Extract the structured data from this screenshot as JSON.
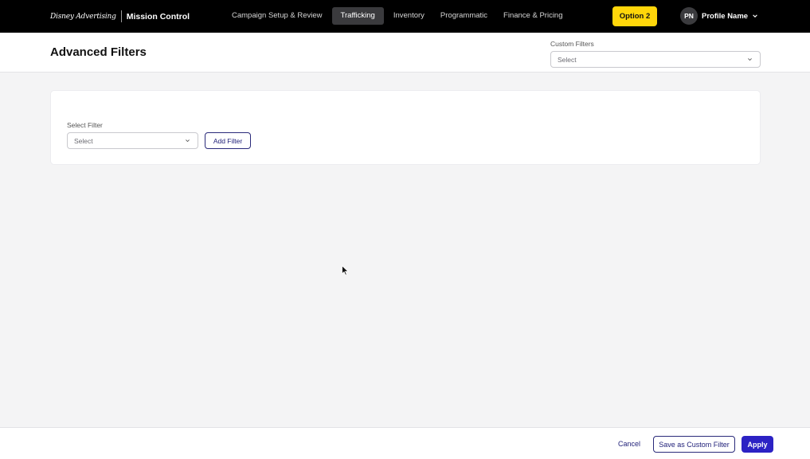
{
  "topbar": {
    "brand_logo": "Disney Advertising",
    "brand_app": "Mission Control",
    "nav": [
      {
        "label": "Campaign Setup & Review",
        "active": false
      },
      {
        "label": "Trafficking",
        "active": true
      },
      {
        "label": "Inventory",
        "active": false
      },
      {
        "label": "Programmatic",
        "active": false
      },
      {
        "label": "Finance & Pricing",
        "active": false
      }
    ],
    "option_button": "Option 2",
    "profile_initials": "PN",
    "profile_name": "Profile Name"
  },
  "header": {
    "title": "Advanced Filters",
    "custom_filters_label": "Custom Filters",
    "custom_filters_value": "Select"
  },
  "filter_card": {
    "select_filter_label": "Select Filter",
    "select_filter_value": "Select",
    "add_filter_button": "Add Filter"
  },
  "footer": {
    "cancel": "Cancel",
    "save_custom": "Save as Custom Filter",
    "apply": "Apply"
  },
  "colors": {
    "topbar_bg": "#000000",
    "accent_yellow": "#ffd60a",
    "primary_blue": "#2c22c4",
    "link_navy": "#22227a"
  },
  "icons": [
    "chevron-down-icon",
    "cursor-arrow-icon"
  ]
}
